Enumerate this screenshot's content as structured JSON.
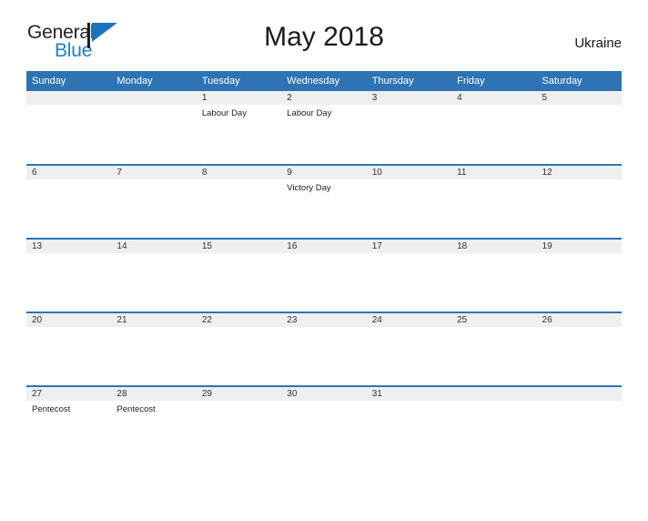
{
  "brand": {
    "name_part1": "General",
    "name_part2": "Blue",
    "flag_icon": "blue-flag-triangle",
    "color_dark": "#231f20",
    "color_blue": "#1b7fd4"
  },
  "header": {
    "title": "May 2018",
    "country": "Ukraine"
  },
  "calendar": {
    "accent_color": "#2e74b5",
    "daynum_band_color": "#efefef",
    "weekday_headers": [
      "Sunday",
      "Monday",
      "Tuesday",
      "Wednesday",
      "Thursday",
      "Friday",
      "Saturday"
    ],
    "weeks": [
      [
        {
          "day": "",
          "events": []
        },
        {
          "day": "",
          "events": []
        },
        {
          "day": "1",
          "events": [
            "Labour Day"
          ]
        },
        {
          "day": "2",
          "events": [
            "Labour Day"
          ]
        },
        {
          "day": "3",
          "events": []
        },
        {
          "day": "4",
          "events": []
        },
        {
          "day": "5",
          "events": []
        }
      ],
      [
        {
          "day": "6",
          "events": []
        },
        {
          "day": "7",
          "events": []
        },
        {
          "day": "8",
          "events": []
        },
        {
          "day": "9",
          "events": [
            "Victory Day"
          ]
        },
        {
          "day": "10",
          "events": []
        },
        {
          "day": "11",
          "events": []
        },
        {
          "day": "12",
          "events": []
        }
      ],
      [
        {
          "day": "13",
          "events": []
        },
        {
          "day": "14",
          "events": []
        },
        {
          "day": "15",
          "events": []
        },
        {
          "day": "16",
          "events": []
        },
        {
          "day": "17",
          "events": []
        },
        {
          "day": "18",
          "events": []
        },
        {
          "day": "19",
          "events": []
        }
      ],
      [
        {
          "day": "20",
          "events": []
        },
        {
          "day": "21",
          "events": []
        },
        {
          "day": "22",
          "events": []
        },
        {
          "day": "23",
          "events": []
        },
        {
          "day": "24",
          "events": []
        },
        {
          "day": "25",
          "events": []
        },
        {
          "day": "26",
          "events": []
        }
      ],
      [
        {
          "day": "27",
          "events": [
            "Pentecost"
          ]
        },
        {
          "day": "28",
          "events": [
            "Pentecost"
          ]
        },
        {
          "day": "29",
          "events": []
        },
        {
          "day": "30",
          "events": []
        },
        {
          "day": "31",
          "events": []
        },
        {
          "day": "",
          "events": []
        },
        {
          "day": "",
          "events": []
        }
      ]
    ]
  }
}
